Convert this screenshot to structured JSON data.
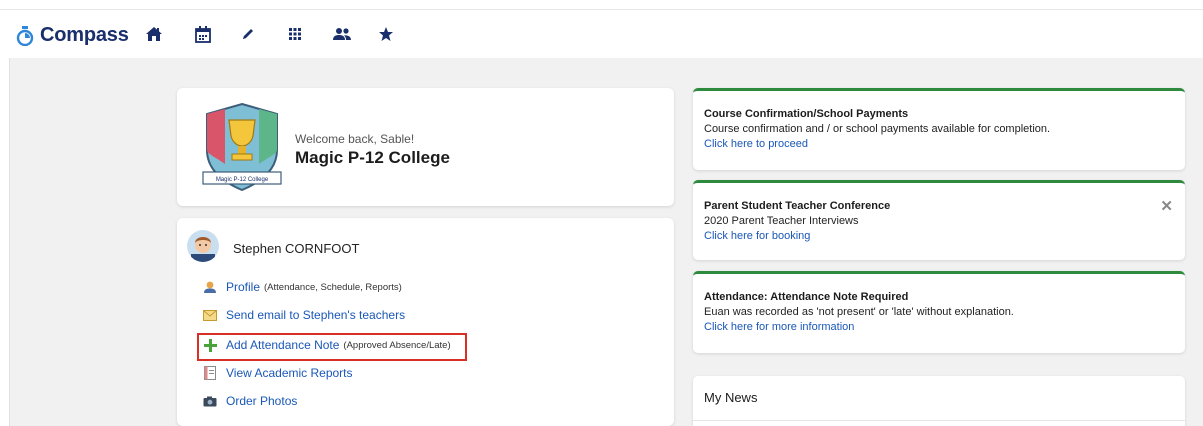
{
  "app": {
    "name": "Compass"
  },
  "nav": [
    {
      "name": "home-icon"
    },
    {
      "name": "calendar-icon"
    },
    {
      "name": "pencil-icon"
    },
    {
      "name": "grid-icon"
    },
    {
      "name": "people-icon"
    },
    {
      "name": "star-icon"
    }
  ],
  "school": {
    "welcome": "Welcome back, Sable!",
    "name": "Magic P-12 College",
    "crest_label": "Magic P-12 College"
  },
  "student": {
    "name": "Stephen CORNFOOT",
    "links": [
      {
        "label": "Profile",
        "sub": "(Attendance, Schedule, Reports)",
        "icon": "profile-icon"
      },
      {
        "label": "Send email to Stephen's teachers",
        "sub": "",
        "icon": "email-icon"
      },
      {
        "label": "Add Attendance Note",
        "sub": "(Approved Absence/Late)",
        "icon": "plus-icon"
      },
      {
        "label": "View Academic Reports",
        "sub": "",
        "icon": "report-icon"
      },
      {
        "label": "Order Photos",
        "sub": "",
        "icon": "camera-icon"
      }
    ]
  },
  "notices": [
    {
      "title": "Course Confirmation/School Payments",
      "text": "Course confirmation and / or school payments available for completion.",
      "link": "Click here to proceed"
    },
    {
      "title": "Parent Student Teacher Conference",
      "text": "2020 Parent Teacher Interviews",
      "link": "Click here for booking",
      "close": "✕"
    },
    {
      "title": "Attendance: Attendance Note Required",
      "text": "Euan was recorded as 'not present' or 'late' without explanation.",
      "link": "Click here for more information"
    }
  ],
  "news": {
    "title": "My News"
  },
  "colors": {
    "brand": "#1a2f6b",
    "link": "#1a57b8",
    "notice_accent": "#2e8b3e",
    "highlight": "#d93025"
  }
}
